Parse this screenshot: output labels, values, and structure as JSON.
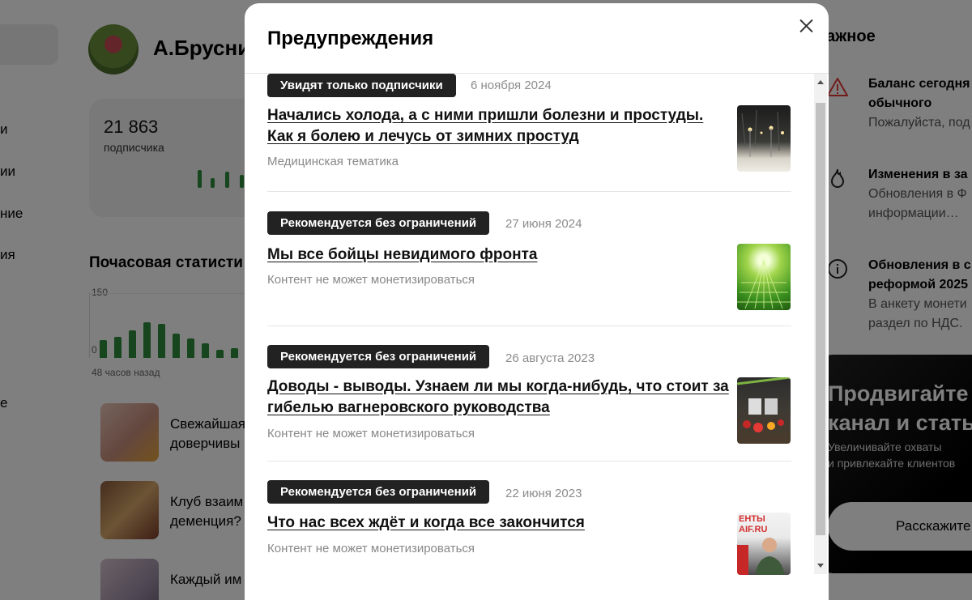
{
  "background": {
    "sidebar_fragments": [
      "и",
      "ии",
      "ние",
      "ия",
      "е"
    ],
    "channel_name": "А.Брусни",
    "stats": {
      "subscribers": "21 863",
      "subscribers_label": "подписчика"
    },
    "hourly": {
      "title": "Почасовая статисти",
      "y_max": "150",
      "y_min": "0",
      "x_label": "48 часов назад"
    },
    "feed": [
      {
        "text": "Свежайшая\nдоверчивы"
      },
      {
        "text": "Клуб взаим\nдеменция?"
      },
      {
        "text": "Каждый им"
      }
    ],
    "right_panel": {
      "title": "ажное",
      "notices": [
        {
          "icon": "warning-icon",
          "title": "Баланс сегодня\nобычного",
          "body": "Пожалуйста, под"
        },
        {
          "icon": "fire-icon",
          "title": "Изменения в за",
          "body": "Обновления в Ф\nинформации…"
        },
        {
          "icon": "info-icon",
          "title": "Обновления в с\nреформой 2025",
          "body": "В анкету монети\nраздел по НДС."
        }
      ],
      "promo": {
        "title": "Продвигайте\nканал и стать",
        "subtitle": "Увеличивайте охваты\nи привлекайте клиентов",
        "button": "Расскажите"
      }
    }
  },
  "modal": {
    "title": "Предупреждения",
    "items": [
      {
        "tag": "Увидят только подписчики",
        "date": "6 ноября 2024",
        "title": "Начались холода, а с ними пришли болезни и простуды. Как я болею и лечусь от зимних простуд",
        "reason": "Медицинская тематика",
        "thumb": "winter-night-thumbnail"
      },
      {
        "tag": "Рекомендуется без ограничений",
        "date": "27 июня 2024",
        "title": "Мы все бойцы невидимого фронта",
        "reason": "Контент не может монетизироваться",
        "thumb": "green-circuit-thumbnail"
      },
      {
        "tag": "Рекомендуется без ограничений",
        "date": "26 августа 2023",
        "title": "Доводы - выводы. Узнаем ли мы когда-нибудь, что стоит за гибелью вагнеровского руководства",
        "reason": "Контент не может монетизироваться",
        "thumb": "memorial-flowers-thumbnail"
      },
      {
        "tag": "Рекомендуется без ограничений",
        "date": "22 июня 2023",
        "title": "Что нас всех ждёт и когда все закончится",
        "reason": "Контент не может монетизироваться",
        "thumb": "news-studio-thumbnail",
        "thumb_text": "ЕНТЫ\nAIF.RU"
      }
    ]
  }
}
